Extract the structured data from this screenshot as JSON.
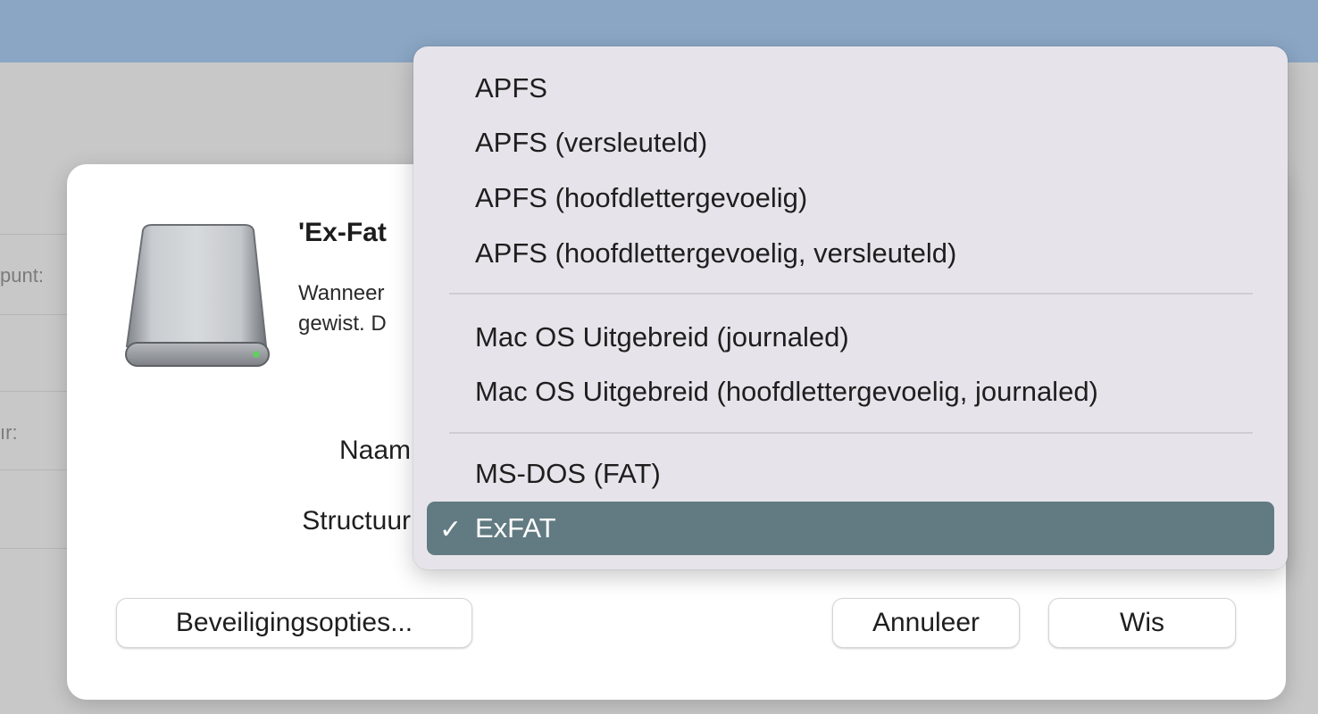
{
  "background": {
    "labels": [
      "punt:",
      "ır:"
    ]
  },
  "sheet": {
    "title": "'Ex-Fat",
    "description_line1": "Wanneer",
    "description_line2": "gewist. D",
    "name_label": "Naam",
    "structure_label": "Structuur",
    "security_button": "Beveiligingsopties...",
    "cancel_button": "Annuleer",
    "erase_button": "Wis"
  },
  "format_menu": {
    "group1": [
      "APFS",
      "APFS (versleuteld)",
      "APFS (hoofdlettergevoelig)",
      "APFS (hoofdlettergevoelig, versleuteld)"
    ],
    "group2": [
      "Mac OS Uitgebreid (journaled)",
      "Mac OS Uitgebreid (hoofdlettergevoelig, journaled)"
    ],
    "group3": [
      "MS-DOS (FAT)",
      "ExFAT"
    ],
    "selected": "ExFAT",
    "check_mark": "✓"
  },
  "colors": {
    "accent_selected": "#627a82",
    "titlebar": "#8aa6c4"
  },
  "icons": {
    "drive": "external-drive-icon",
    "check": "checkmark-icon"
  }
}
